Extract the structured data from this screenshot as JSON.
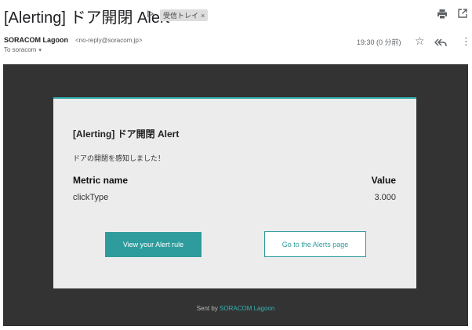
{
  "header": {
    "subject": "[Alerting] ドア開閉 Alert",
    "important_mark": "ᐅ",
    "label_chip": "受信トレイ",
    "label_chip_close": "×",
    "icons": [
      "print-icon",
      "open-in-new-window-icon"
    ]
  },
  "sender": {
    "name": "SORACOM Lagoon",
    "email": "<no-reply@soracom.jp>",
    "recipient": "To soracom",
    "recipient_caret": "▾",
    "timestamp": "19:30 (0 分前)",
    "icons": [
      "star-icon",
      "reply-all-icon",
      "more-vert-icon"
    ]
  },
  "email_body": {
    "title": "[Alerting] ドア開閉 Alert",
    "message": "ドアの開閉を感知しました！",
    "table": {
      "headers": [
        "Metric name",
        "Value"
      ],
      "rows": [
        {
          "metric": "clickType",
          "value": "3.000"
        }
      ]
    },
    "primary_button": "View your Alert rule",
    "secondary_button": "Go to the Alerts page",
    "footer_prefix": "Sent by ",
    "footer_link": "SORACOM Lagoon"
  },
  "colors": {
    "accent": "#2e9c9d",
    "frame_background": "#333333",
    "card_background": "#ececec"
  }
}
